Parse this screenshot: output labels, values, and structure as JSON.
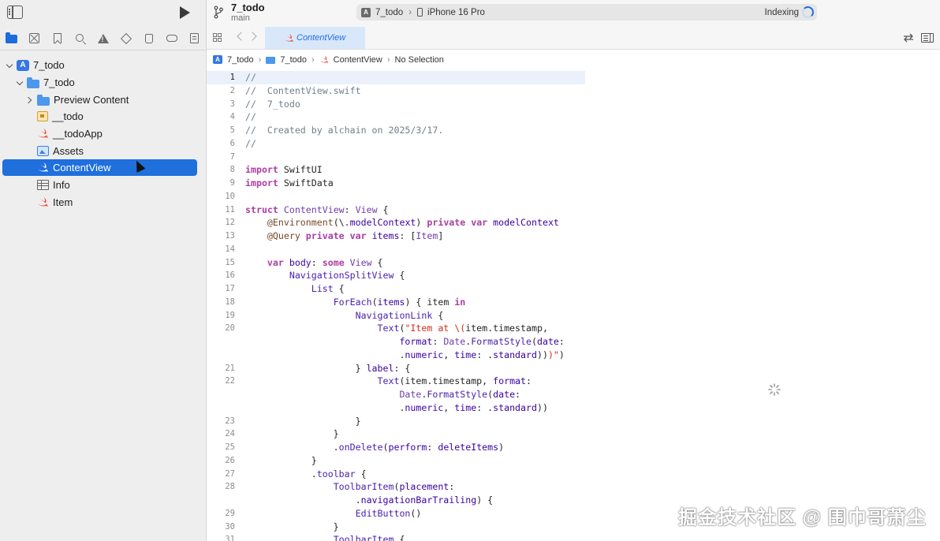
{
  "toolbar": {
    "project_name": "7_todo",
    "branch": "main",
    "scheme": "7_todo",
    "device": "iPhone 16 Pro",
    "status": "Indexing"
  },
  "editor_tab": {
    "label": "ContentView"
  },
  "jumpbar": {
    "project": "7_todo",
    "group": "7_todo",
    "file": "ContentView",
    "symbol": "No Selection"
  },
  "navigator": {
    "items": [
      {
        "label": "7_todo"
      },
      {
        "label": "7_todo"
      },
      {
        "label": "Preview Content"
      },
      {
        "label": "__todo"
      },
      {
        "label": "__todoApp"
      },
      {
        "label": "Assets"
      },
      {
        "label": "ContentView"
      },
      {
        "label": "Info"
      },
      {
        "label": "Item"
      }
    ]
  },
  "code": {
    "line_numbers": [
      "1",
      "2",
      "3",
      "4",
      "5",
      "6",
      "7",
      "8",
      "9",
      "10",
      "11",
      "12",
      "13",
      "14",
      "15",
      "16",
      "17",
      "18",
      "19",
      "20",
      "",
      "",
      "21",
      "22",
      "",
      "",
      "23",
      "24",
      "25",
      "26",
      "27",
      "28",
      "",
      "29",
      "30",
      "31"
    ]
  },
  "watermark": "掘金技术社区 @ 围巾哥萧尘",
  "colors": {
    "accent": "#1f6fdd",
    "selection": "#1f6fdd",
    "keyword": "#ad3da4",
    "string": "#d12f1b",
    "comment": "#707f8c"
  }
}
